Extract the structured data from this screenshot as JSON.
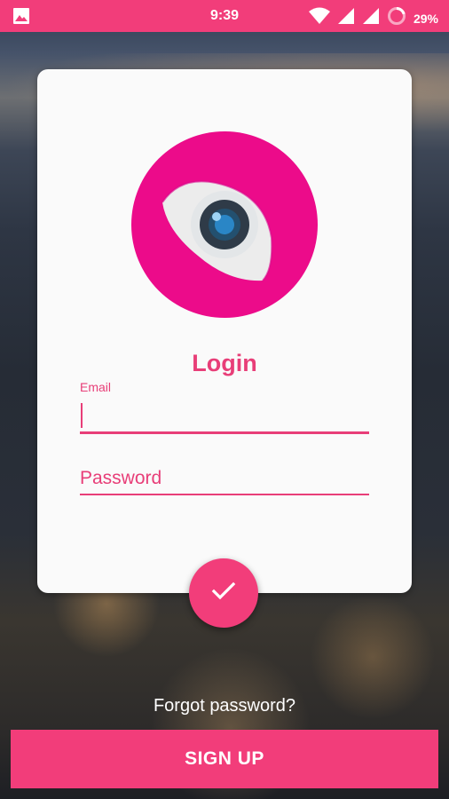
{
  "status_bar": {
    "time": "9:39",
    "battery_percent": "29%",
    "icons": [
      "gallery-icon",
      "wifi-icon",
      "signal-icon",
      "signal-icon",
      "battery-icon"
    ]
  },
  "login_card": {
    "title": "Login",
    "email": {
      "label": "Email",
      "value": ""
    },
    "password": {
      "placeholder": "Password",
      "value": ""
    }
  },
  "forgot_password": "Forgot password?",
  "signup_label": "SIGN UP",
  "colors": {
    "accent": "#f23d7a",
    "accent_text": "#e83e78",
    "card": "#fafafa"
  }
}
